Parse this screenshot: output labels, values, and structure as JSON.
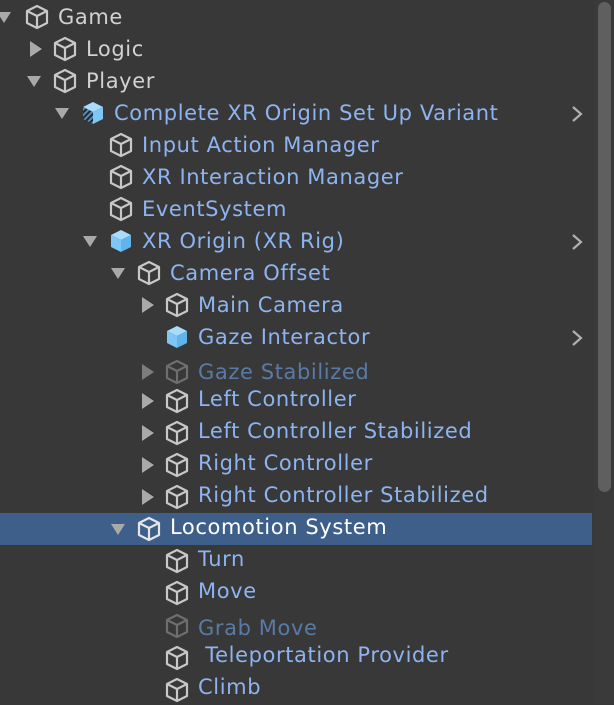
{
  "hierarchy": {
    "items": [
      {
        "label": "Game",
        "icon": "gameobject-icon",
        "expand": "expanded",
        "style": "plain"
      },
      {
        "label": "Logic",
        "icon": "gameobject-icon",
        "expand": "collapsed",
        "style": "plain"
      },
      {
        "label": "Player",
        "icon": "gameobject-icon",
        "expand": "expanded",
        "style": "plain"
      },
      {
        "label": "Complete XR Origin Set Up Variant",
        "icon": "prefab-variant-icon",
        "expand": "expanded",
        "style": "prefab",
        "chevron": true
      },
      {
        "label": "Input Action Manager",
        "icon": "gameobject-icon",
        "style": "prefab"
      },
      {
        "label": "XR Interaction Manager",
        "icon": "gameobject-icon",
        "style": "prefab"
      },
      {
        "label": "EventSystem",
        "icon": "gameobject-icon",
        "style": "prefab"
      },
      {
        "label": "XR Origin (XR Rig)",
        "icon": "prefab-icon",
        "expand": "expanded",
        "style": "prefab",
        "chevron": true
      },
      {
        "label": "Camera Offset",
        "icon": "gameobject-icon",
        "expand": "expanded",
        "style": "prefab"
      },
      {
        "label": "Main Camera",
        "icon": "gameobject-icon",
        "expand": "collapsed",
        "style": "prefab"
      },
      {
        "label": "Gaze Interactor",
        "icon": "prefab-icon",
        "style": "prefab",
        "chevron": true
      },
      {
        "label": "Gaze Stabilized",
        "icon": "gameobject-icon",
        "expand": "collapsed",
        "style": "disabled"
      },
      {
        "label": "Left Controller",
        "icon": "gameobject-icon",
        "expand": "collapsed",
        "style": "prefab"
      },
      {
        "label": "Left Controller Stabilized",
        "icon": "gameobject-icon",
        "expand": "collapsed",
        "style": "prefab"
      },
      {
        "label": "Right Controller",
        "icon": "gameobject-icon",
        "expand": "collapsed",
        "style": "prefab"
      },
      {
        "label": "Right Controller Stabilized",
        "icon": "gameobject-icon",
        "expand": "collapsed",
        "style": "prefab"
      },
      {
        "label": "Locomotion System",
        "icon": "gameobject-icon",
        "expand": "expanded",
        "style": "sel",
        "selected": true
      },
      {
        "label": "Turn",
        "icon": "gameobject-icon",
        "style": "prefab"
      },
      {
        "label": "Move",
        "icon": "gameobject-icon",
        "style": "prefab"
      },
      {
        "label": "Grab Move",
        "icon": "gameobject-icon",
        "style": "disabled"
      },
      {
        "label": " Teleportation Provider",
        "icon": "gameobject-icon",
        "style": "prefab"
      },
      {
        "label": "Climb",
        "icon": "gameobject-icon",
        "style": "prefab"
      }
    ]
  },
  "colors": {
    "background": "#383838",
    "selection": "#3e5f8a",
    "prefab_text": "#8db4f0",
    "plain_text": "#d2d2d2",
    "disabled_text": "#5a7aa6",
    "prefab_icon_fill": "#7ec6f5"
  }
}
